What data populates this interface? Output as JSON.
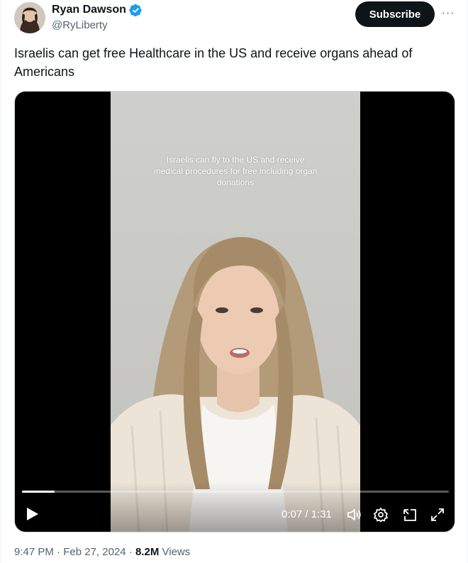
{
  "author": {
    "display_name": "Ryan Dawson",
    "handle": "@RyLiberty",
    "verified": true
  },
  "actions": {
    "subscribe_label": "Subscribe",
    "more_label": "···"
  },
  "tweet": {
    "text": "Israelis can get free Healthcare in the US and receive organs ahead of Americans"
  },
  "video": {
    "caption": "Israelis can fly to the US and receive medical procedures for free including organ donations",
    "current_time": "0:07",
    "duration": "1:31",
    "time_display": "0:07 / 1:31",
    "progress_fraction": 0.077
  },
  "meta": {
    "time": "9:47 PM",
    "date": "Feb 27, 2024",
    "separator": "·",
    "views_count": "8.2M",
    "views_label": "Views"
  },
  "colors": {
    "verified_blue": "#1d9bf0",
    "text_primary": "#0f1419",
    "text_secondary": "#536471",
    "button_dark": "#0f1419"
  },
  "icons": [
    "verified-badge-icon",
    "more-icon",
    "play-icon",
    "volume-icon",
    "settings-icon",
    "pip-icon",
    "fullscreen-icon"
  ]
}
